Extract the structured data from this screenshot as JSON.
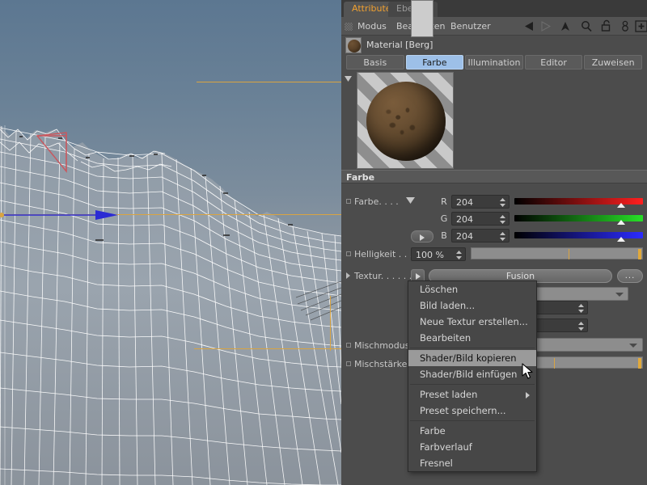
{
  "window": {
    "tabs": [
      {
        "label": "Attribute",
        "active": true
      },
      {
        "label": "Ebenen",
        "active": false
      }
    ],
    "menus": [
      "Modus",
      "Bearbeiten",
      "Benutzer"
    ],
    "toolbar_icons": [
      "back-arrow-icon",
      "forward-arrow-icon",
      "up-arrow-icon",
      "search-icon",
      "lock-open-icon",
      "pin-icon",
      "new-view-icon"
    ],
    "grip_icon": "drag-grip-icon"
  },
  "material": {
    "title": "Material [Berg]",
    "thumbnail_icon": "material-sphere-icon",
    "tabs": [
      {
        "label": "Basis",
        "selected": false
      },
      {
        "label": "Farbe",
        "selected": true
      },
      {
        "label": "Illumination",
        "selected": false
      },
      {
        "label": "Editor",
        "selected": false
      },
      {
        "label": "Zuweisen",
        "selected": false
      }
    ],
    "preview_collapse_icon": "triangle-down-icon"
  },
  "color_section": {
    "heading": "Farbe",
    "color_row": {
      "label": "Farbe. . . .",
      "swatch_hex": "#cccccc",
      "channels": [
        {
          "name": "R",
          "value": "204",
          "knob_pct": 80
        },
        {
          "name": "G",
          "value": "204",
          "knob_pct": 80
        },
        {
          "name": "B",
          "value": "204",
          "knob_pct": 80
        }
      ]
    },
    "brightness_row": {
      "label": "Helligkeit . . .",
      "value": "100 %",
      "slider_pct": 100
    },
    "texture_row": {
      "label": "Textur. . . . . .",
      "value": "Fusion",
      "browse_label": "...",
      "arrow_icon": "triangle-right-icon"
    },
    "mix_mode_row": {
      "label": "Mischmodus",
      "value": ""
    },
    "mix_strength_row": {
      "label": "Mischstärke",
      "value": ""
    }
  },
  "context_menu": {
    "items": [
      {
        "label": "Löschen",
        "highlighted": false,
        "submenu": false,
        "sep_after": false
      },
      {
        "label": "Bild laden...",
        "highlighted": false,
        "submenu": false,
        "sep_after": false
      },
      {
        "label": "Neue Textur erstellen...",
        "highlighted": false,
        "submenu": false,
        "sep_after": false
      },
      {
        "label": "Bearbeiten",
        "highlighted": false,
        "submenu": false,
        "sep_after": true
      },
      {
        "label": "Shader/Bild kopieren",
        "highlighted": true,
        "submenu": false,
        "sep_after": false
      },
      {
        "label": "Shader/Bild einfügen",
        "highlighted": false,
        "submenu": false,
        "sep_after": true
      },
      {
        "label": "Preset laden",
        "highlighted": false,
        "submenu": true,
        "sep_after": false
      },
      {
        "label": "Preset speichern...",
        "highlighted": false,
        "submenu": false,
        "sep_after": true
      },
      {
        "label": "Farbe",
        "highlighted": false,
        "submenu": false,
        "sep_after": false
      },
      {
        "label": "Farbverlauf",
        "highlighted": false,
        "submenu": false,
        "sep_after": false
      },
      {
        "label": "Fresnel",
        "highlighted": false,
        "submenu": false,
        "sep_after": false
      }
    ]
  },
  "viewport": {
    "object_icon": "terrain-wireframe",
    "axis_color": "#d9a441",
    "z_axis_color": "#2b2bd4",
    "light_gizmo_color": "#c8585f"
  },
  "cursor": {
    "icon": "arrow-cursor"
  },
  "colors": {
    "panel_bg": "#4c4c4c",
    "accent_tab": "#f0a030",
    "tab_selected": "#9dc0e8",
    "menu_highlight": "#9a9a9a",
    "sky_top": "#5c7791",
    "sky_bottom": "#7d858d"
  }
}
